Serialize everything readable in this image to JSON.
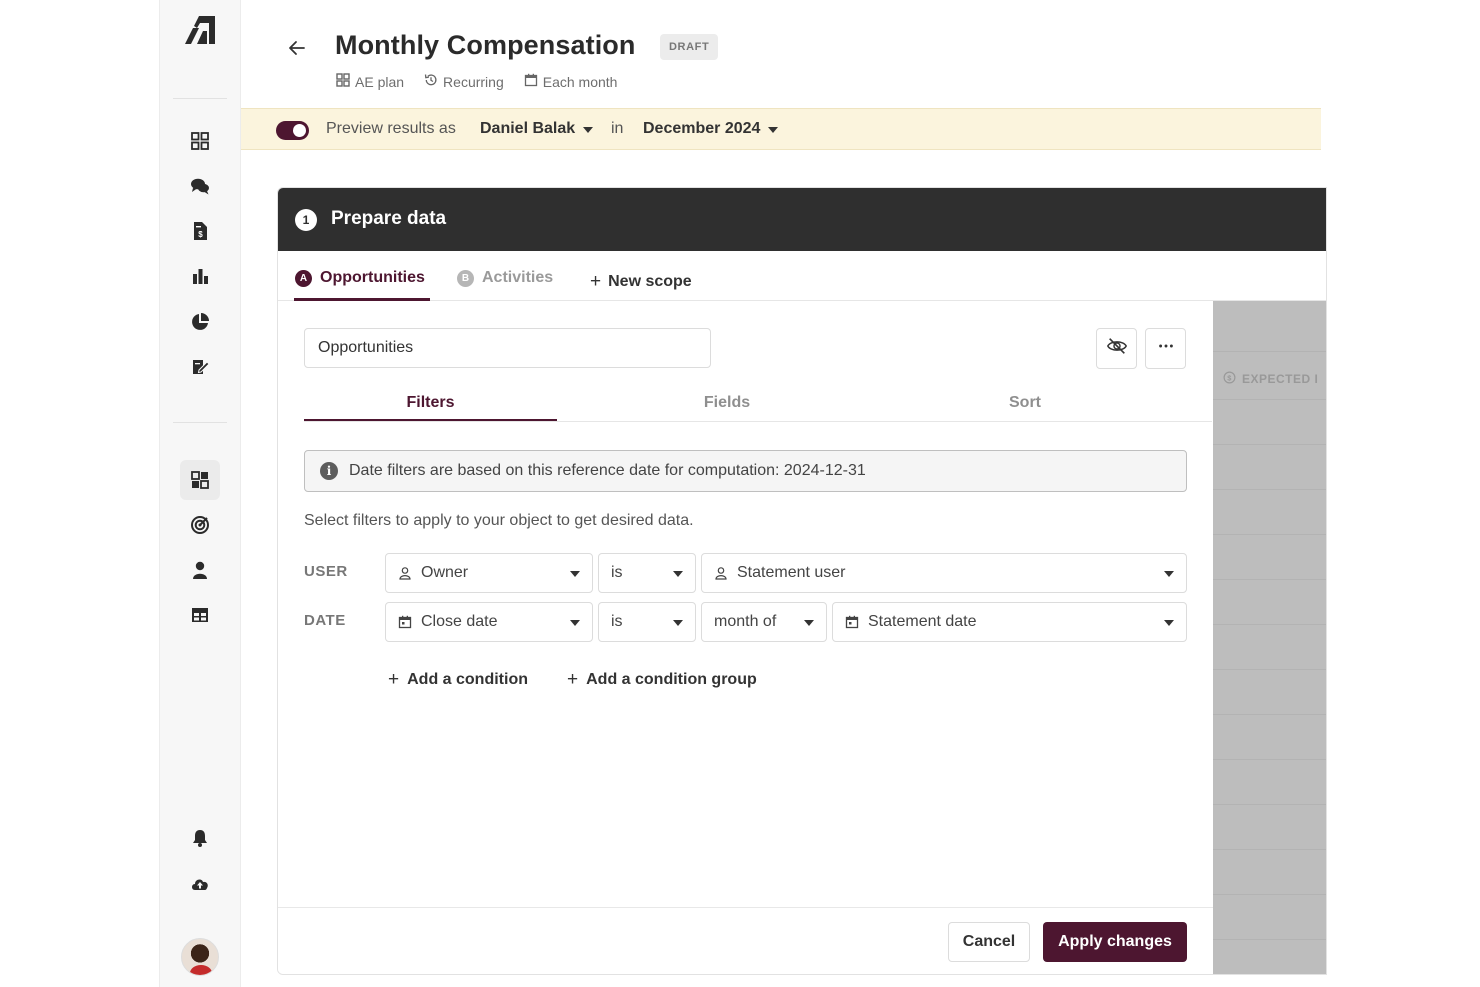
{
  "header": {
    "title": "Monthly Compensation",
    "status_badge": "DRAFT",
    "meta": [
      {
        "label": "AE plan",
        "icon": "grid-icon"
      },
      {
        "label": "Recurring",
        "icon": "history-icon"
      },
      {
        "label": "Each month",
        "icon": "calendar-icon"
      }
    ]
  },
  "preview": {
    "enabled": true,
    "label": "Preview results as",
    "user": "Daniel Balak",
    "in_label": "in",
    "period": "December 2024"
  },
  "section": {
    "step_number": "1",
    "title": "Prepare data"
  },
  "scopes": {
    "tabs": [
      {
        "badge": "A",
        "label": "Opportunities",
        "active": true
      },
      {
        "badge": "B",
        "label": "Activities",
        "active": false
      }
    ],
    "new_scope_label": "New scope"
  },
  "scope_name_value": "Opportunities",
  "sub_tabs": [
    "Filters",
    "Fields",
    "Sort"
  ],
  "info_message": "Date filters are based on this reference date for computation: 2024-12-31",
  "hint": "Select filters to apply to your object to get desired data.",
  "filters": {
    "user_row": {
      "label": "USER",
      "field": "Owner",
      "operator": "is",
      "value": "Statement user"
    },
    "date_row": {
      "label": "DATE",
      "field": "Close date",
      "operator": "is",
      "modifier": "month of",
      "value": "Statement date"
    }
  },
  "actions": {
    "add_condition": "Add a condition",
    "add_condition_group": "Add a condition group",
    "cancel": "Cancel",
    "apply": "Apply changes"
  },
  "side_panel": {
    "column_label": "EXPECTED I"
  },
  "colors": {
    "accent": "#4d1630",
    "header_dark": "#2f2f2f",
    "preview_bg": "#fbf4dd"
  }
}
